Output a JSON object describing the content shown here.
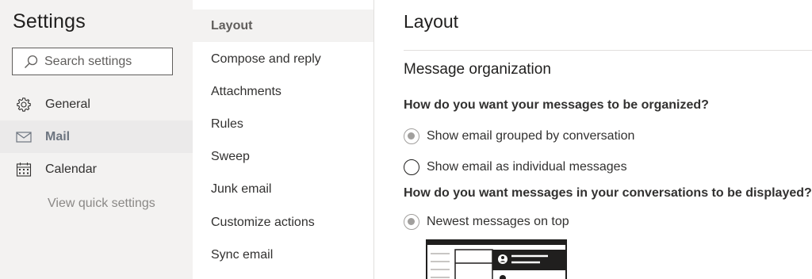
{
  "settings_panel": {
    "title": "Settings",
    "search_placeholder": "Search settings",
    "nav": [
      {
        "label": "General",
        "icon": "gear-icon",
        "active": false
      },
      {
        "label": "Mail",
        "icon": "mail-icon",
        "active": true
      },
      {
        "label": "Calendar",
        "icon": "calendar-icon",
        "active": false
      }
    ],
    "quick_settings_link": "View quick settings"
  },
  "mail_menu": {
    "items": [
      {
        "label": "Layout",
        "active": true
      },
      {
        "label": "Compose and reply",
        "active": false
      },
      {
        "label": "Attachments",
        "active": false
      },
      {
        "label": "Rules",
        "active": false
      },
      {
        "label": "Sweep",
        "active": false
      },
      {
        "label": "Junk email",
        "active": false
      },
      {
        "label": "Customize actions",
        "active": false
      },
      {
        "label": "Sync email",
        "active": false
      }
    ]
  },
  "content": {
    "page_title": "Layout",
    "section_title": "Message organization",
    "question_1": "How do you want your messages to be organized?",
    "options_1": [
      {
        "label": "Show email grouped by conversation",
        "checked": true
      },
      {
        "label": "Show email as individual messages",
        "checked": false
      }
    ],
    "question_2": "How do you want messages in your conversations to be displayed?",
    "options_2": [
      {
        "label": "Newest messages on top",
        "checked": true
      }
    ]
  },
  "colors": {
    "left_bg": "#f3f2f1",
    "active_nav_bg": "#ebeaea",
    "radio_checked": "#a19f9d",
    "divider": "#e1dfdd"
  }
}
